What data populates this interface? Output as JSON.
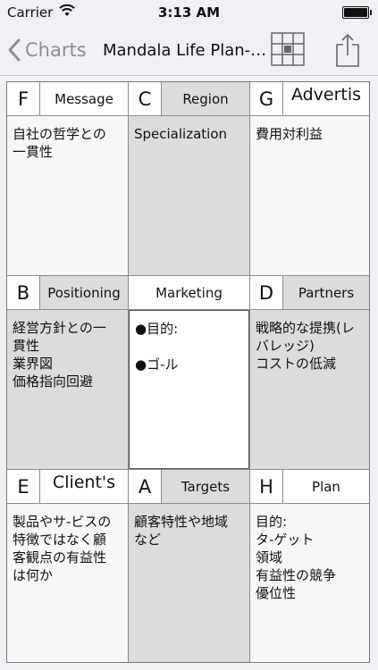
{
  "status_bar": {
    "carrier": "Carrier",
    "time": "3:13 AM"
  },
  "nav": {
    "back_label": "Charts",
    "title": "Mandala Life Plan-…"
  },
  "cells": {
    "f": {
      "letter": "F",
      "label": "Message",
      "lines": [
        "自社の哲学との",
        "一貫性"
      ]
    },
    "c": {
      "letter": "C",
      "label": "Region",
      "lines": [
        "Specialization"
      ]
    },
    "g": {
      "letter": "G",
      "label": "Advertis",
      "lines": [
        "費用対利益"
      ]
    },
    "b": {
      "letter": "B",
      "label": "Positioning",
      "lines": [
        "経営方針との一",
        "貫性",
        "業界図",
        "価格指向回避"
      ]
    },
    "center": {
      "label": "Marketing",
      "line1": "●目的:",
      "line2": "●ゴ-ル"
    },
    "d": {
      "letter": "D",
      "label": "Partners",
      "lines": [
        "戦略的な提携(レ",
        "バレッジ)",
        "コストの低減"
      ]
    },
    "e": {
      "letter": "E",
      "label": "Client's",
      "lines": [
        "製品やサ-ビスの",
        "特徴ではなく顧",
        "客観点の有益性",
        "は何か"
      ]
    },
    "a": {
      "letter": "A",
      "label": "Targets",
      "lines": [
        "顧客特性や地域",
        "など"
      ]
    },
    "h": {
      "letter": "H",
      "label": "Plan",
      "lines": [
        "目的:",
        "タ-ゲット",
        "領域",
        "有益性の競争",
        "優位性"
      ]
    }
  }
}
